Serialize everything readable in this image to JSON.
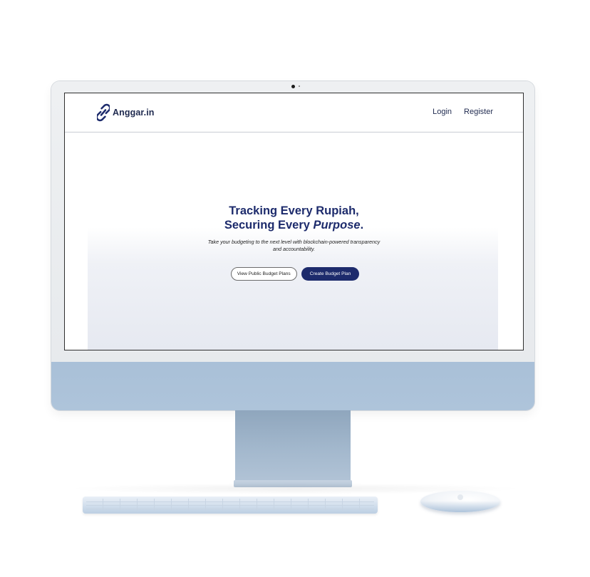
{
  "app": {
    "name": "Anggar.in",
    "logo_icon": "link-chain-icon"
  },
  "nav": {
    "links": [
      {
        "label": "Login"
      },
      {
        "label": "Register"
      }
    ]
  },
  "hero": {
    "line1_prefix": "Tracking Every ",
    "line1_bold": "Rupiah",
    "line1_suffix": ",",
    "line2_prefix": "Securing Every ",
    "line2_bold_italic": "Purpose",
    "line2_suffix": ".",
    "subtitle_line1": "Take your budgeting to the next level with blockchain-powered transparency",
    "subtitle_line2": "and accountability."
  },
  "buttons": {
    "secondary": "View Public Budget Plans",
    "primary": "Create Budget Plan"
  },
  "colors": {
    "brand_navy": "#1d2b6c",
    "imac_blue": "#aec4da"
  }
}
